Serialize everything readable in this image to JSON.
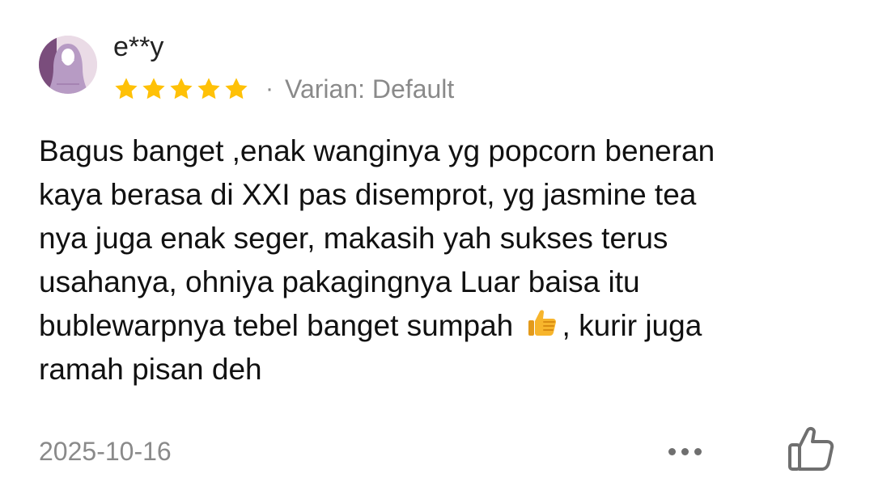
{
  "review": {
    "username": "e**y",
    "rating": 5,
    "rating_max": 5,
    "separator": "·",
    "variant": "Varian: Default",
    "text_lines": [
      "Bagus banget ,enak wanginya yg popcorn beneran",
      "kaya berasa di XXI pas disemprot, yg jasmine tea",
      "nya juga enak seger, makasih yah sukses terus",
      "usahanya, ohniya pakagingnya Luar baisa itu",
      "bublewarpnya tebel banget sumpah",
      ", kurir juga",
      "ramah pisan deh"
    ],
    "inline_emoji": "thumbs-up-emoji",
    "date": "2025-10-16"
  },
  "icons": {
    "avatar": "hijab-woman-avatar",
    "star": "star-icon",
    "more": "more-horizontal-icon",
    "like": "thumbs-up-outline-icon"
  },
  "colors": {
    "star": "#FFC107",
    "muted_text": "#8A8A8A",
    "body_text": "#111111",
    "emoji": "#F7B52C"
  }
}
